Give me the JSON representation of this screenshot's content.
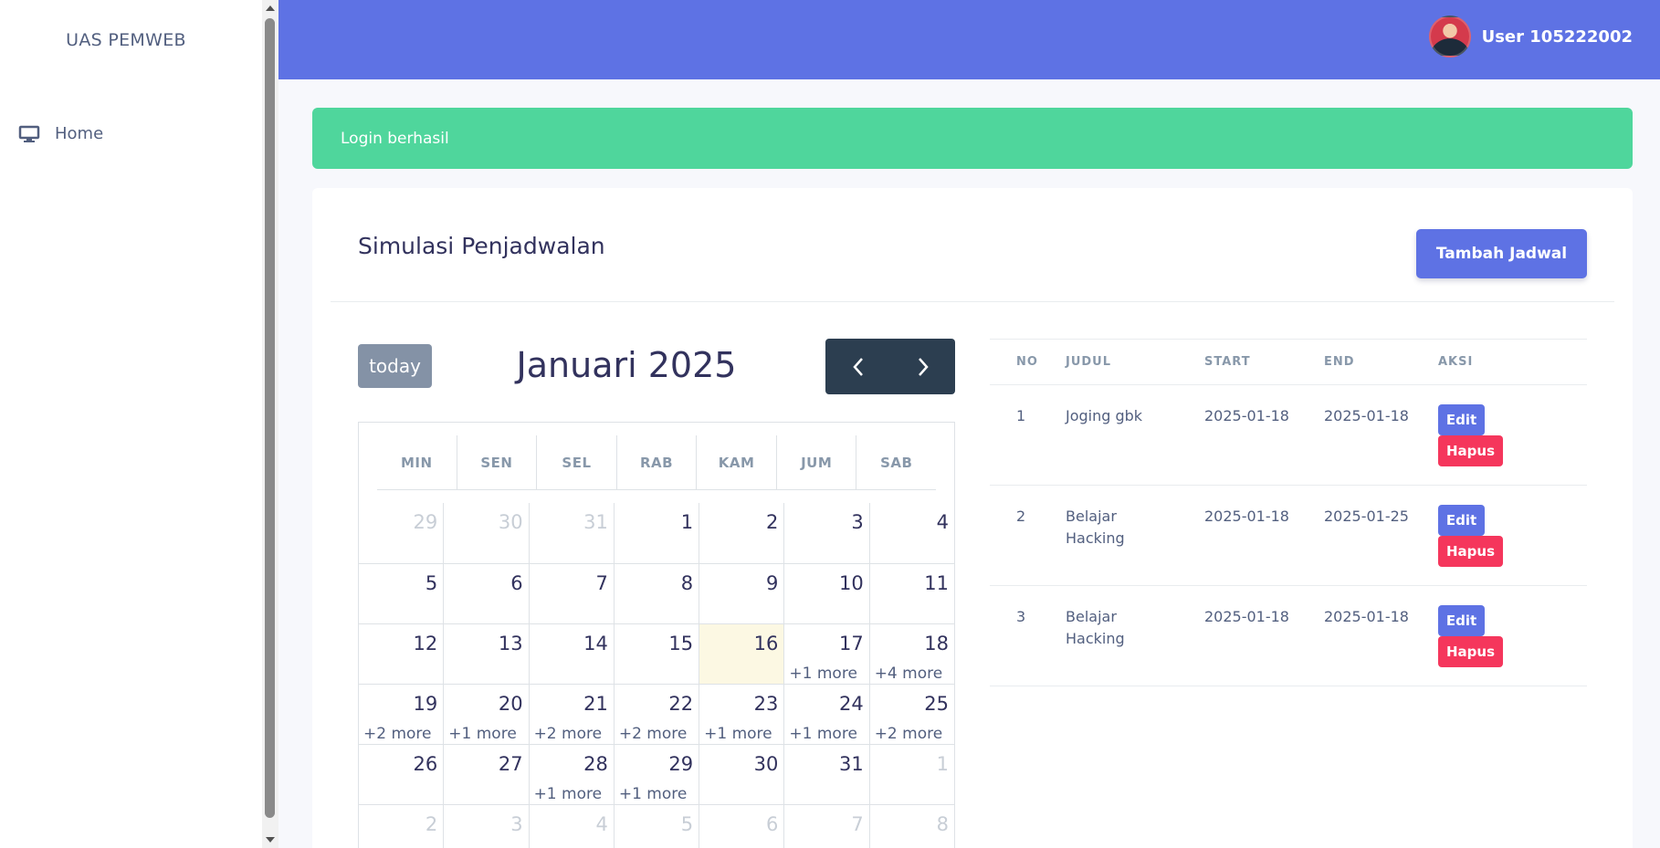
{
  "sidebar": {
    "brand": "UAS PEMWEB",
    "items": [
      {
        "label": "Home",
        "icon": "desktop-icon"
      }
    ]
  },
  "topbar": {
    "user_name": "User 105222002",
    "accent": "#5e72e4"
  },
  "alert": {
    "text": "Login berhasil",
    "color": "#4fd69c"
  },
  "card": {
    "title": "Simulasi Penjadwalan",
    "add_button": "Tambah Jadwal"
  },
  "calendar": {
    "today_button": "today",
    "title": "Januari 2025",
    "prev_icon": "chevron-left-icon",
    "next_icon": "chevron-right-icon",
    "weekdays": [
      "MIN",
      "SEN",
      "SEL",
      "RAB",
      "KAM",
      "JUM",
      "SAB"
    ],
    "today_day": "16",
    "weeks": [
      [
        {
          "d": "29",
          "other": true
        },
        {
          "d": "30",
          "other": true
        },
        {
          "d": "31",
          "other": true
        },
        {
          "d": "1"
        },
        {
          "d": "2"
        },
        {
          "d": "3"
        },
        {
          "d": "4"
        }
      ],
      [
        {
          "d": "5"
        },
        {
          "d": "6"
        },
        {
          "d": "7"
        },
        {
          "d": "8"
        },
        {
          "d": "9"
        },
        {
          "d": "10"
        },
        {
          "d": "11"
        }
      ],
      [
        {
          "d": "12"
        },
        {
          "d": "13"
        },
        {
          "d": "14"
        },
        {
          "d": "15"
        },
        {
          "d": "16",
          "today": true
        },
        {
          "d": "17",
          "more": "+1 more"
        },
        {
          "d": "18",
          "more": "+4 more"
        }
      ],
      [
        {
          "d": "19",
          "more": "+2 more"
        },
        {
          "d": "20",
          "more": "+1 more"
        },
        {
          "d": "21",
          "more": "+2 more"
        },
        {
          "d": "22",
          "more": "+2 more"
        },
        {
          "d": "23",
          "more": "+1 more"
        },
        {
          "d": "24",
          "more": "+1 more"
        },
        {
          "d": "25",
          "more": "+2 more"
        }
      ],
      [
        {
          "d": "26"
        },
        {
          "d": "27"
        },
        {
          "d": "28",
          "more": "+1 more"
        },
        {
          "d": "29",
          "more": "+1 more"
        },
        {
          "d": "30"
        },
        {
          "d": "31"
        },
        {
          "d": "1",
          "other": true
        }
      ],
      [
        {
          "d": "2",
          "other": true
        },
        {
          "d": "3",
          "other": true
        },
        {
          "d": "4",
          "other": true
        },
        {
          "d": "5",
          "other": true
        },
        {
          "d": "6",
          "other": true
        },
        {
          "d": "7",
          "other": true
        },
        {
          "d": "8",
          "other": true
        }
      ]
    ]
  },
  "table": {
    "headers": [
      "NO",
      "JUDUL",
      "START",
      "END",
      "AKSI"
    ],
    "edit_label": "Edit",
    "delete_label": "Hapus",
    "rows": [
      {
        "no": "1",
        "judul": "Joging gbk",
        "start": "2025-01-18",
        "end": "2025-01-18"
      },
      {
        "no": "2",
        "judul": "Belajar Hacking",
        "start": "2025-01-18",
        "end": "2025-01-25"
      },
      {
        "no": "3",
        "judul": "Belajar Hacking",
        "start": "2025-01-18",
        "end": "2025-01-18"
      }
    ]
  }
}
